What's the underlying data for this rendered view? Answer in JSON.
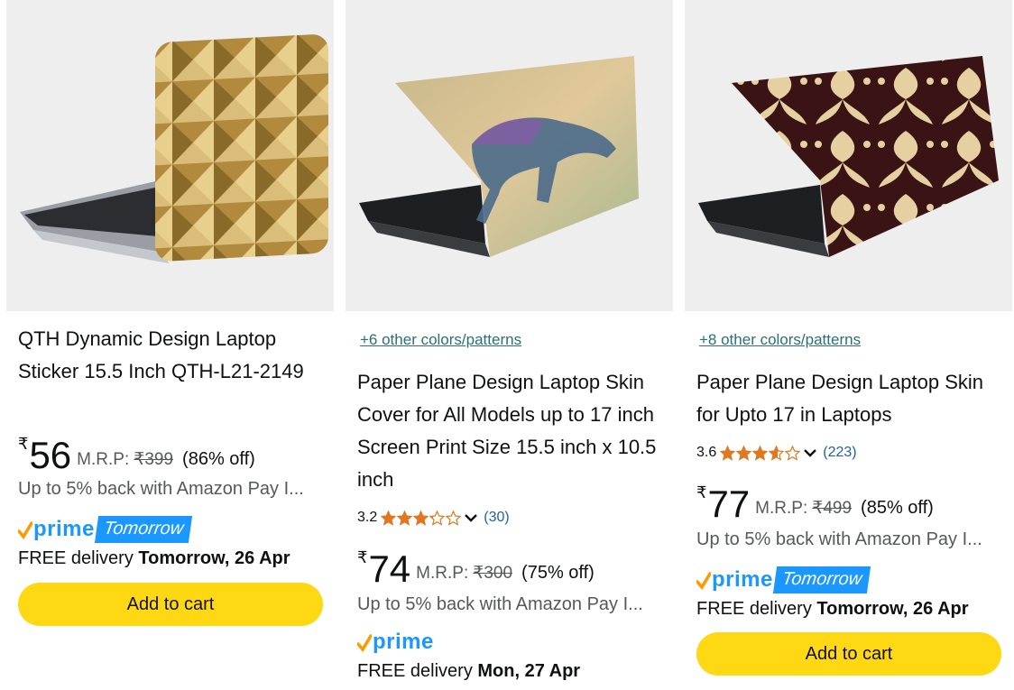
{
  "colors": {
    "accent": "#1a98ff",
    "cart_button": "#ffd814",
    "link": "#2a6f7a",
    "star": "#de7921"
  },
  "products": [
    {
      "title": "QTH Dynamic Design Laptop Sticker 15.5 Inch QTH-L21-2149",
      "price_symbol": "₹",
      "price": "56",
      "mrp_label": "M.R.P:",
      "mrp": "₹399",
      "discount": "(86% off)",
      "cashback": "Up to 5% back with Amazon Pay I...",
      "prime_word": "prime",
      "prime_badge": "Tomorrow",
      "delivery_prefix": "FREE delivery ",
      "delivery_date": "Tomorrow, 26 Apr",
      "cart_label": "Add to cart"
    },
    {
      "colors_link": "+6 other colors/patterns",
      "title": "Paper Plane Design Laptop Skin Cover for All Models up to 17 inch Screen Print Size 15.5 inch x 10.5 inch",
      "rating": "3.2",
      "rating_count": "(30)",
      "stars": 3.2,
      "price_symbol": "₹",
      "price": "74",
      "mrp_label": "M.R.P:",
      "mrp": "₹300",
      "discount": "(75% off)",
      "cashback": "Up to 5% back with Amazon Pay I...",
      "prime_word": "prime",
      "delivery_prefix": "FREE delivery ",
      "delivery_date": "Mon, 27 Apr"
    },
    {
      "colors_link": "+8 other colors/patterns",
      "title": "Paper Plane Design Laptop Skin for Upto 17 in Laptops",
      "rating": "3.6",
      "rating_count": "(223)",
      "stars": 3.6,
      "price_symbol": "₹",
      "price": "77",
      "mrp_label": "M.R.P:",
      "mrp": "₹499",
      "discount": "(85% off)",
      "cashback": "Up to 5% back with Amazon Pay I...",
      "prime_word": "prime",
      "prime_badge": "Tomorrow",
      "delivery_prefix": "FREE delivery ",
      "delivery_date": "Tomorrow, 26 Apr",
      "cart_label": "Add to cart"
    }
  ]
}
